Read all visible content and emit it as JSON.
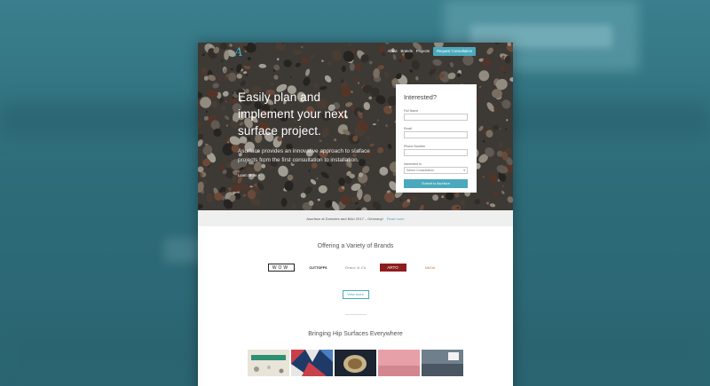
{
  "site": {
    "logo": "A",
    "nav": {
      "items": [
        "About",
        "Brands",
        "Projects"
      ],
      "cta": "Request Consultation"
    },
    "hero": {
      "title": "Easily plan and implement your next surface project.",
      "subtitle": "Asurface provides an innovative approach to surface projects from the first consultation to installation.",
      "learn_more": "Learn More »"
    },
    "form": {
      "title": "Interested?",
      "fields": {
        "full_name": "Full Name",
        "email": "Email",
        "phone": "Phone Number",
        "interested_in": "Interested In"
      },
      "select_value": "Select Consultation",
      "submit": "Submit to Asurface"
    },
    "announcement": {
      "text": "Asurface at Domotex and BAU 2017 – Germany!",
      "link": "Read more"
    },
    "brands_section": {
      "title": "Offering a Variety of Brands",
      "brands": [
        "WOW",
        "CUTTOFFS",
        "Grace & Co",
        "ARTO",
        "MASIA"
      ],
      "view_more": "View more"
    },
    "hip_section": {
      "title": "Bringing Hip Surfaces Everywhere"
    },
    "colors": {
      "accent": "#4aa9bd",
      "background": "#2f6f7d"
    }
  }
}
